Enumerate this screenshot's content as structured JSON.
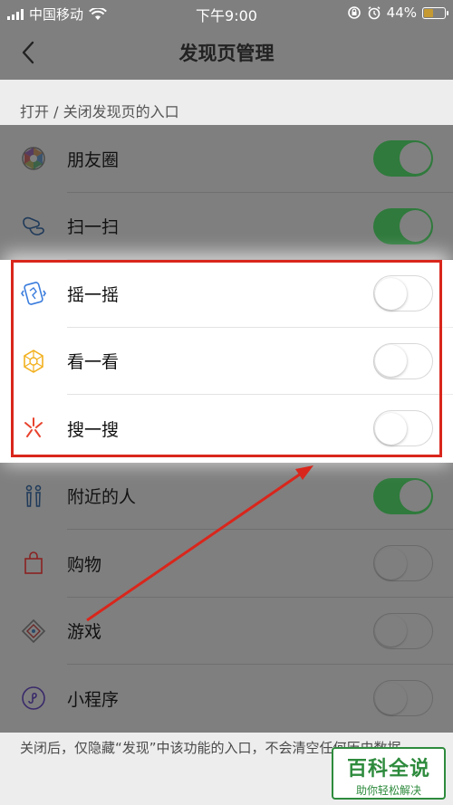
{
  "status_bar": {
    "carrier": "中国移动",
    "time": "下午9:00",
    "battery": "44%"
  },
  "nav": {
    "title": "发现页管理"
  },
  "section": {
    "caption": "打开 / 关闭发现页的入口"
  },
  "items": [
    {
      "label": "朋友圈",
      "on": true,
      "icon": "moments-icon"
    },
    {
      "label": "扫一扫",
      "on": true,
      "icon": "scan-icon"
    },
    {
      "label": "摇一摇",
      "on": false,
      "icon": "shake-icon"
    },
    {
      "label": "看一看",
      "on": false,
      "icon": "top-stories-icon"
    },
    {
      "label": "搜一搜",
      "on": false,
      "icon": "search-icon"
    },
    {
      "label": "附近的人",
      "on": true,
      "icon": "people-nearby-icon"
    },
    {
      "label": "购物",
      "on": false,
      "icon": "shopping-icon"
    },
    {
      "label": "游戏",
      "on": false,
      "icon": "games-icon"
    },
    {
      "label": "小程序",
      "on": false,
      "icon": "mini-programs-icon"
    }
  ],
  "footer": {
    "note": "关闭后，仅隐藏“发现”中该功能的入口，不会清空任何历史数据。"
  },
  "watermark": {
    "title": "百科全说",
    "subtitle": "助你轻松解决"
  },
  "colors": {
    "toggle_on": "#2f7a3c",
    "highlight_border": "#d9261c",
    "watermark": "#2e8b3d"
  }
}
